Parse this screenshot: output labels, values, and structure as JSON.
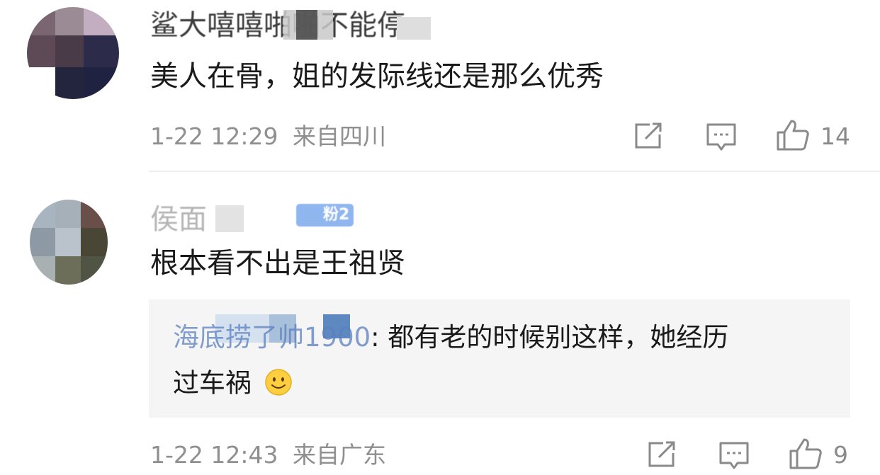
{
  "comments": [
    {
      "username": "鲨大嘻嘻啪啪不能停",
      "text": "美人在骨，姐的发际线还是那么优秀",
      "time": "1-22 12:29",
      "location": "来自四川",
      "likes": "14"
    },
    {
      "username": "侯面",
      "badge": "粉2",
      "text": "根本看不出是王祖贤",
      "reply": {
        "author": "海底捞了帅1900",
        "colon": ":",
        "text_line1": " 都有老的时候别这样，她经历",
        "text_line2": "过车祸",
        "emoji": "smile-emoji"
      },
      "time": "1-22 12:43",
      "location": "来自广东",
      "likes": "9"
    }
  ],
  "icons": {
    "share": "share-icon",
    "comment": "comment-icon",
    "like": "thumbs-up-icon"
  },
  "colors": {
    "meta": "#8f8f8f",
    "link": "#5a7fbf",
    "reply_bg": "#f5f5f5",
    "divider": "#ededed"
  }
}
